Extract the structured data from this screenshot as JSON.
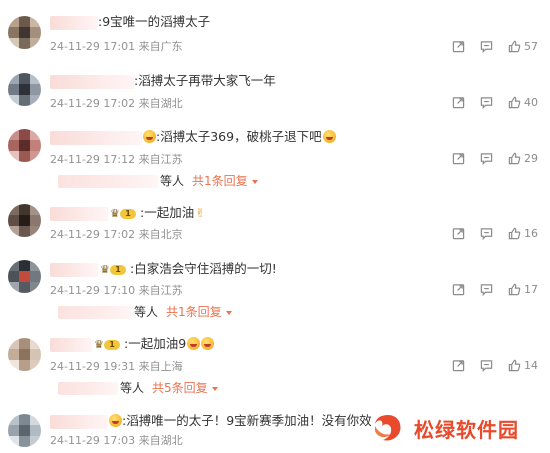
{
  "comments": [
    {
      "text": ":9宝唯一的滔搏太子",
      "time": "24-11-29 17:01",
      "location": "来自广东",
      "likes": "57",
      "badge": false,
      "reply_summary": null
    },
    {
      "text": ":滔搏太子再带大家飞一年",
      "time": "24-11-29 17:02",
      "location": "来自湖北",
      "likes": "40",
      "badge": false,
      "reply_summary": null
    },
    {
      "text": ":滔搏太子369，破桃子退下吧",
      "time": "24-11-29 17:12",
      "location": "来自江苏",
      "likes": "29",
      "badge": false,
      "reply_summary": {
        "suffix": "等人",
        "link": "共1条回复"
      }
    },
    {
      "text": ":一起加油",
      "time": "24-11-29 17:02",
      "location": "来自北京",
      "likes": "16",
      "badge": true,
      "reply_summary": null
    },
    {
      "text": ":白家浩会守住滔搏的一切!",
      "time": "24-11-29 17:10",
      "location": "来自江苏",
      "likes": "17",
      "badge": true,
      "reply_summary": {
        "suffix": "等人",
        "link": "共1条回复"
      }
    },
    {
      "text": ":一起加油9",
      "time": "24-11-29 19:31",
      "location": "来自上海",
      "likes": "14",
      "badge": true,
      "reply_summary": {
        "suffix": "等人",
        "link": "共5条回复"
      }
    },
    {
      "text": ":滔搏唯一的太子！9宝新赛季加油！没有你效",
      "time": "24-11-29 17:03",
      "location": "来自湖北",
      "likes": "",
      "badge": false,
      "reply_summary": null
    }
  ],
  "badge_level": "1",
  "watermark": {
    "text": "松绿软件园",
    "brand_color": "#e84a2b"
  },
  "colors": {
    "link": "#eb7350",
    "meta": "#939393",
    "text": "#333333",
    "icon": "#8c8c8c"
  },
  "icons": {
    "share": "share-icon",
    "comment": "comment-icon",
    "like": "thumbs-up-icon",
    "reply_caret": "caret-down-icon"
  }
}
